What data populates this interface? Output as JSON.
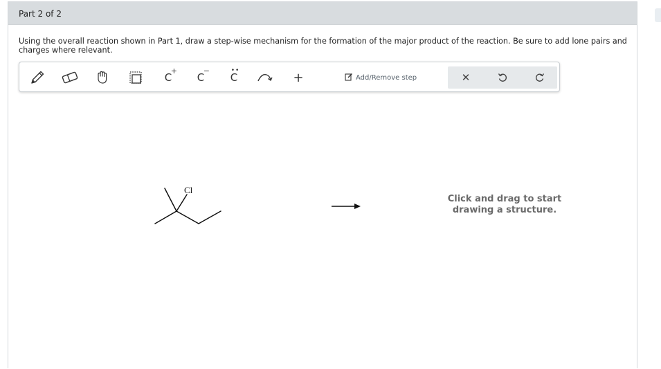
{
  "header": {
    "part_label": "Part 2 of 2"
  },
  "question": {
    "text": "Using the overall reaction shown in Part 1, draw a step-wise mechanism for the formation of the major product of the reaction. Be sure to add lone pairs and charges where relevant."
  },
  "toolbar": {
    "tools": [
      {
        "name": "pencil-icon"
      },
      {
        "name": "eraser-icon"
      },
      {
        "name": "hand-icon"
      },
      {
        "name": "select-box-icon"
      },
      {
        "name": "carbocation-icon",
        "symbol": "C",
        "sup": "+"
      },
      {
        "name": "carbanion-icon",
        "symbol": "C",
        "sup": "−"
      },
      {
        "name": "lone-pair-icon",
        "symbol": "C"
      },
      {
        "name": "curved-arrow-icon"
      },
      {
        "name": "plus-icon",
        "symbol": "+"
      }
    ],
    "step_label": "Add/Remove step",
    "actions": [
      {
        "name": "clear-icon",
        "symbol": "✕"
      },
      {
        "name": "undo-icon"
      },
      {
        "name": "redo-icon"
      }
    ]
  },
  "canvas": {
    "atom_label": "Cl",
    "hint": "Click and drag to start drawing a structure."
  }
}
